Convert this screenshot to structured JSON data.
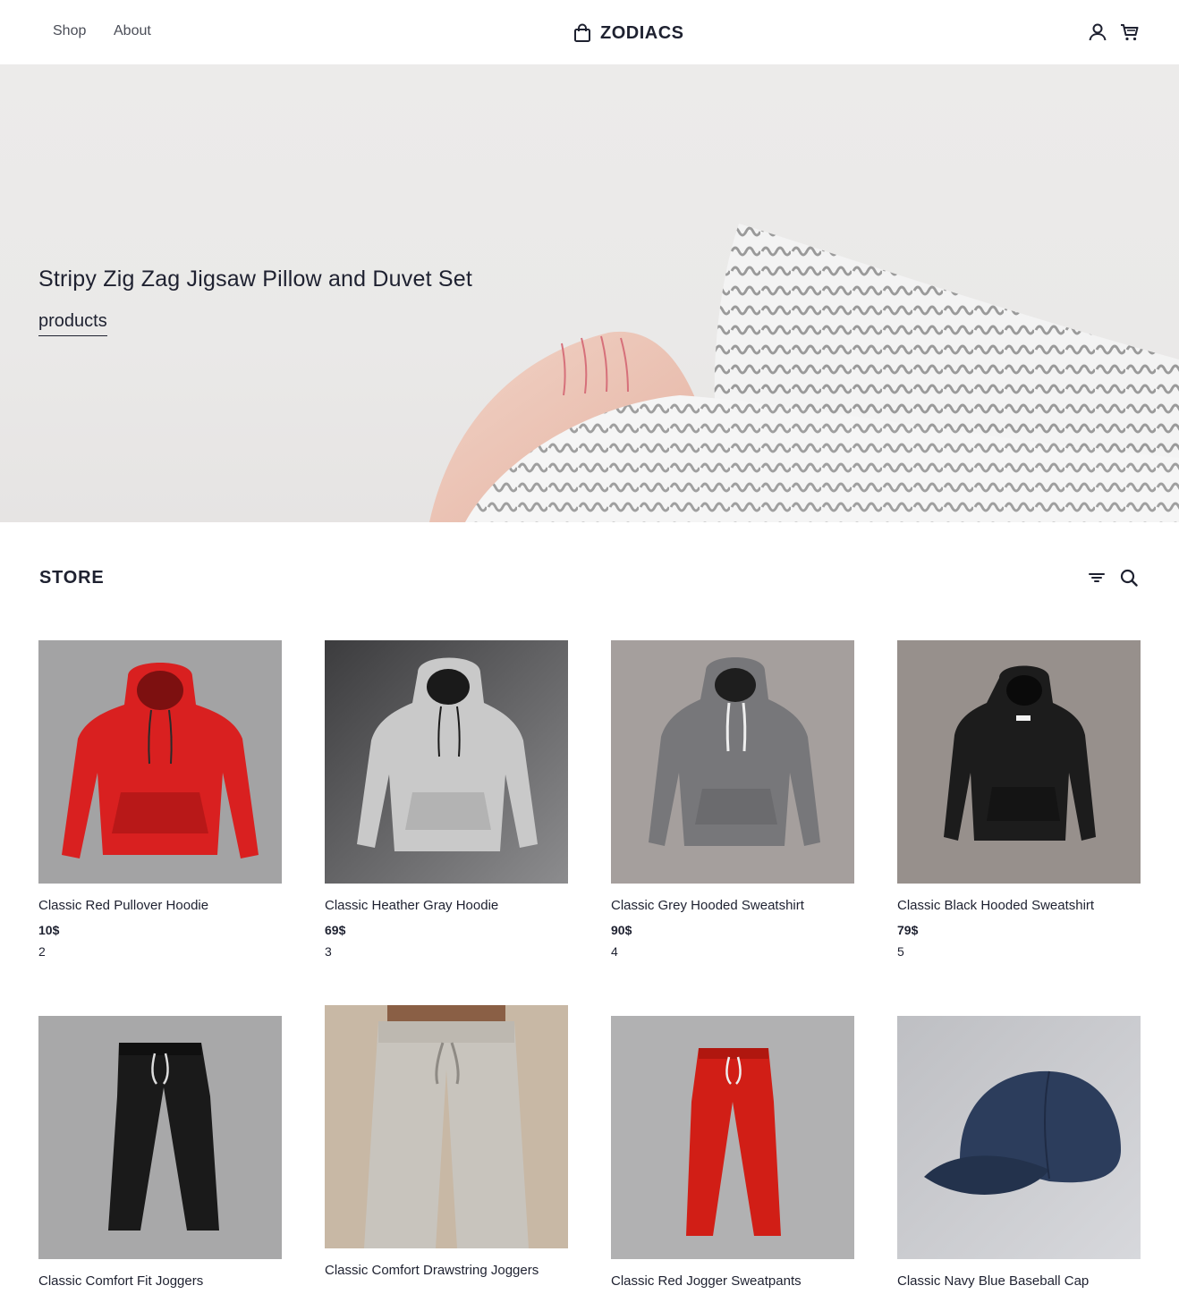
{
  "header": {
    "nav": [
      {
        "label": "Shop"
      },
      {
        "label": "About"
      }
    ],
    "brand": "ZODIACS",
    "icons": [
      "shopping-bag-icon",
      "user-icon",
      "cart-icon"
    ]
  },
  "hero": {
    "title": "Stripy Zig Zag Jigsaw Pillow and Duvet Set",
    "link": "products"
  },
  "store": {
    "title": "STORE",
    "tools": [
      "filter-icon",
      "search-icon"
    ],
    "products": [
      {
        "name": "Classic Red Pullover Hoodie",
        "price": "10$",
        "qty": "2",
        "color": "#d92020"
      },
      {
        "name": "Classic Heather Gray Hoodie",
        "price": "69$",
        "qty": "3",
        "color": "#c9c9c9"
      },
      {
        "name": "Classic Grey Hooded Sweatshirt",
        "price": "90$",
        "qty": "4",
        "color": "#77777a"
      },
      {
        "name": "Classic Black Hooded Sweatshirt",
        "price": "79$",
        "qty": "5",
        "color": "#1c1c1c"
      },
      {
        "name": "Classic Comfort Fit Joggers",
        "color": "#1a1a1a"
      },
      {
        "name": "Classic Comfort Drawstring Joggers",
        "color": "#c8c4bd"
      },
      {
        "name": "Classic Red Jogger Sweatpants",
        "color": "#d11e16"
      },
      {
        "name": "Classic Navy Blue Baseball Cap",
        "color": "#2c3d5c"
      }
    ]
  }
}
